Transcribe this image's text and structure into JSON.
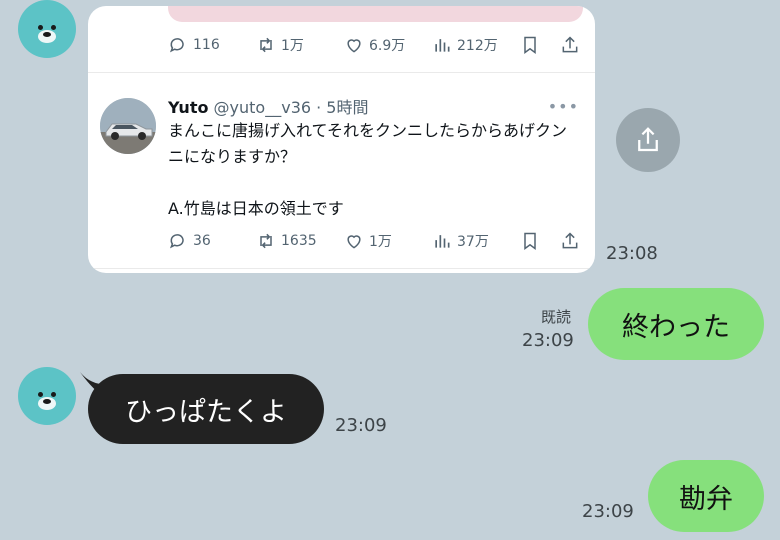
{
  "tweet_card": {
    "top_metrics": {
      "replies": "116",
      "retweets": "1万",
      "likes": "6.9万",
      "views": "212万"
    },
    "tweet": {
      "author_name": "Yuto",
      "handle_time": "@yuto__v36 · 5時間",
      "body": "まんこに唐揚げ入れてそれをクンニしたらからあげクンニになりますか？\n\nA.竹島は日本の領土です",
      "metrics": {
        "replies": "36",
        "retweets": "1635",
        "likes": "1万",
        "views": "37万"
      }
    }
  },
  "messages": [
    {
      "time": "23:08"
    },
    {
      "read_label": "既読",
      "time": "23:09",
      "text": "終わった"
    },
    {
      "text": "ひっぱたくよ",
      "time": "23:09"
    },
    {
      "time": "23:09",
      "text": "勘弁"
    }
  ],
  "colors": {
    "background": "#c4d1d9",
    "sent_bubble": "#86e07c",
    "received_bubble": "#222222",
    "avatar": "#5cc3c6"
  }
}
